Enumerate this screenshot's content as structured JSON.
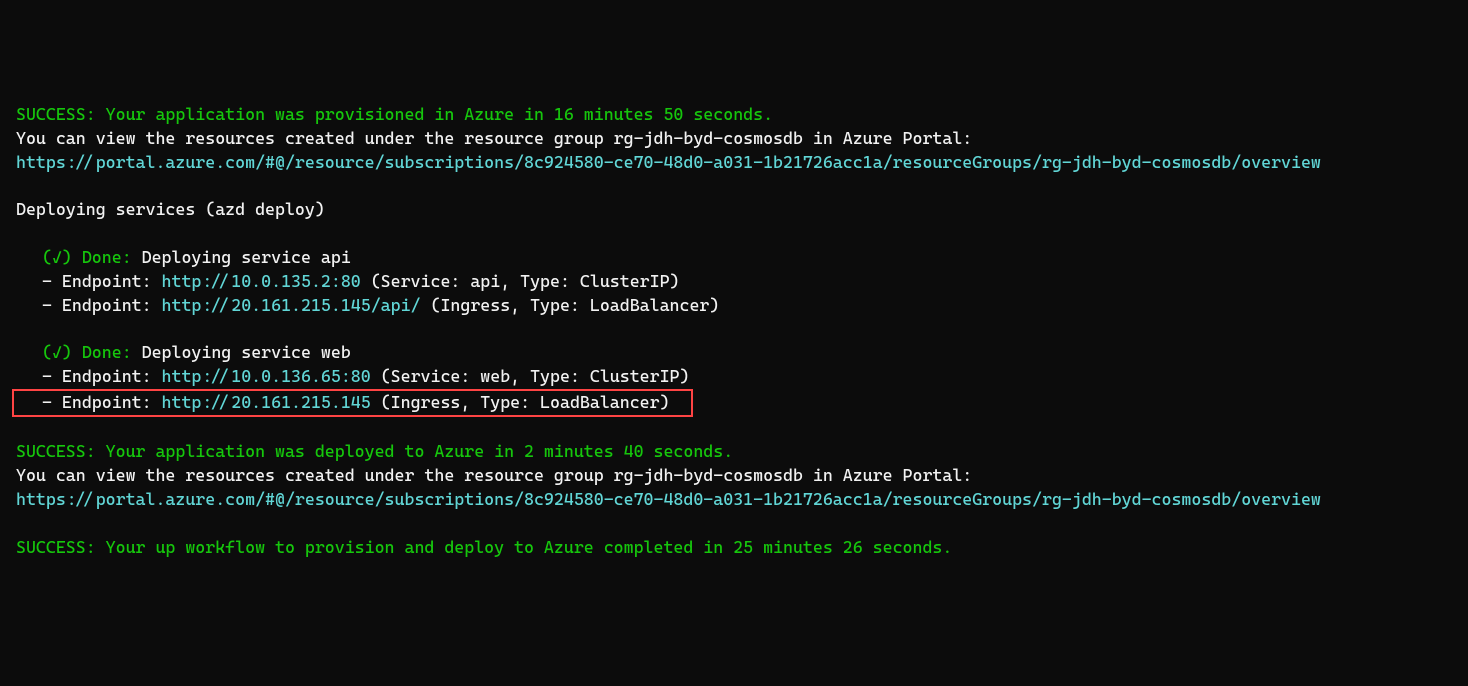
{
  "success1": {
    "prefix": "SUCCESS:",
    "message": " Your application was provisioned in Azure in 16 minutes 50 seconds."
  },
  "portal_msg": "You can view the resources created under the resource group rg-jdh-byd-cosmosdb in Azure Portal:",
  "portal_url": "https://portal.azure.com/#@/resource/subscriptions/8c924580-ce70-48d0-a031-1b21726acc1a/resourceGroups/rg-jdh-byd-cosmosdb/overview",
  "deploy_header": "Deploying services (azd deploy)",
  "service_api": {
    "done_prefix": "(✓) ",
    "done_label": "Done:",
    "done_text": " Deploying service api",
    "endpoint1_prefix": "- Endpoint: ",
    "endpoint1_url": "http://10.0.135.2:80",
    "endpoint1_suffix": " (Service: api, Type: ClusterIP)",
    "endpoint2_prefix": "- Endpoint: ",
    "endpoint2_url": "http://20.161.215.145/api/",
    "endpoint2_suffix": " (Ingress, Type: LoadBalancer)"
  },
  "service_web": {
    "done_prefix": "(✓) ",
    "done_label": "Done:",
    "done_text": " Deploying service web",
    "endpoint1_prefix": "- Endpoint: ",
    "endpoint1_url": "http://10.0.136.65:80",
    "endpoint1_suffix": " (Service: web, Type: ClusterIP)",
    "endpoint2_prefix": "- Endpoint: ",
    "endpoint2_url": "http://20.161.215.145",
    "endpoint2_suffix": " (Ingress, Type: LoadBalancer)"
  },
  "success2": {
    "prefix": "SUCCESS:",
    "message": " Your application was deployed to Azure in 2 minutes 40 seconds."
  },
  "success3": {
    "prefix": "SUCCESS:",
    "message": " Your up workflow to provision and deploy to Azure completed in 25 minutes 26 seconds."
  }
}
